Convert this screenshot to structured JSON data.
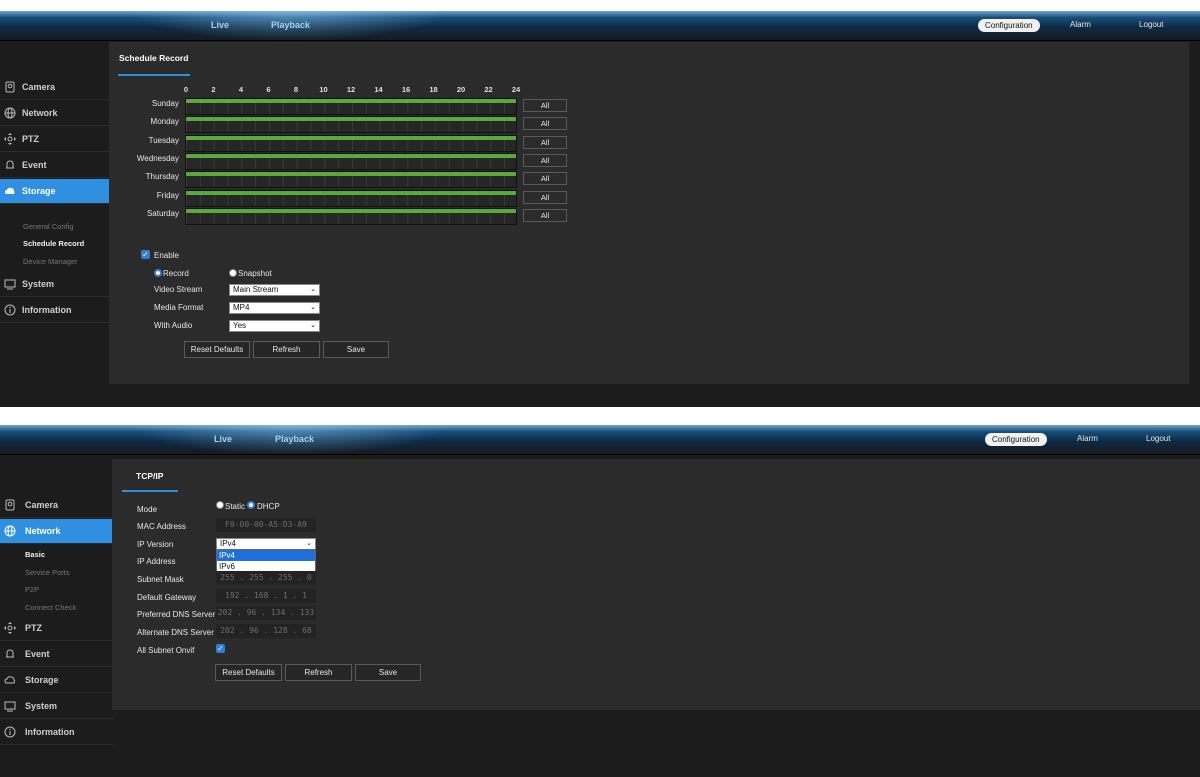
{
  "panel1": {
    "nav": {
      "live": "Live",
      "playback": "Playback"
    },
    "top_right": {
      "configuration": "Configuration",
      "alarm": "Alarm",
      "logout": "Logout"
    },
    "sidebar": {
      "items": [
        {
          "label": "Camera",
          "icon": "camera-icon"
        },
        {
          "label": "Network",
          "icon": "globe-icon"
        },
        {
          "label": "PTZ",
          "icon": "ptz-icon"
        },
        {
          "label": "Event",
          "icon": "bell-icon"
        },
        {
          "label": "Storage",
          "icon": "cloud-icon",
          "active": true
        },
        {
          "label": "System",
          "icon": "monitor-icon"
        },
        {
          "label": "Information",
          "icon": "info-icon"
        }
      ],
      "sub_items": [
        "General Config",
        "Schedule Record",
        "Device Manager"
      ]
    },
    "tab": "Schedule Record",
    "hours": [
      "0",
      "2",
      "4",
      "6",
      "8",
      "10",
      "12",
      "14",
      "16",
      "18",
      "20",
      "22",
      "24"
    ],
    "days": [
      "Sunday",
      "Monday",
      "Tuesday",
      "Wednesday",
      "Thursday",
      "Friday",
      "Saturday"
    ],
    "all_label": "All",
    "enable_label": "Enable",
    "record_label": "Record",
    "snapshot_label": "Snapshot",
    "video_stream_label": "Video Stream",
    "video_stream_value": "Main Stream",
    "media_format_label": "Media Format",
    "media_format_value": "MP4",
    "with_audio_label": "With Audio",
    "with_audio_value": "Yes",
    "reset_label": "Reset Defaults",
    "refresh_label": "Refresh",
    "save_label": "Save"
  },
  "panel2": {
    "nav": {
      "live": "Live",
      "playback": "Playback"
    },
    "top_right": {
      "configuration": "Configuration",
      "alarm": "Alarm",
      "logout": "Logout"
    },
    "sidebar": {
      "items": [
        {
          "label": "Camera",
          "icon": "camera-icon"
        },
        {
          "label": "Network",
          "icon": "globe-icon",
          "active": true
        },
        {
          "label": "PTZ",
          "icon": "ptz-icon"
        },
        {
          "label": "Event",
          "icon": "bell-icon"
        },
        {
          "label": "Storage",
          "icon": "cloud-icon"
        },
        {
          "label": "System",
          "icon": "monitor-icon"
        },
        {
          "label": "Information",
          "icon": "info-icon"
        }
      ],
      "sub_items": [
        "Basic",
        "Service Ports",
        "P2P",
        "Connect Check"
      ]
    },
    "tab": "TCP/IP",
    "mode_label": "Mode",
    "static_label": "Static",
    "dhcp_label": "DHCP",
    "mac_label": "MAC Address",
    "mac_value": "F0-00-00-A5-D3-A9",
    "ip_version_label": "IP Version",
    "ip_version_value": "IPv4",
    "ip_version_options": [
      "IPv4",
      "IPv6"
    ],
    "ip_address_label": "IP Address",
    "subnet_label": "Subnet Mask",
    "subnet_value": "255 . 255 . 255 .  0",
    "gateway_label": "Default Gateway",
    "gateway_value": "192 . 168 .  1  .  1",
    "pdns_label": "Preferred DNS Server",
    "pdns_value": "202 .  96 . 134 . 133",
    "adns_label": "Alternate DNS Server",
    "adns_value": "202 .  96 . 128 .  68",
    "onvif_label": "All Subnet Onvif",
    "reset_label": "Reset Defaults",
    "refresh_label": "Refresh",
    "save_label": "Save"
  }
}
